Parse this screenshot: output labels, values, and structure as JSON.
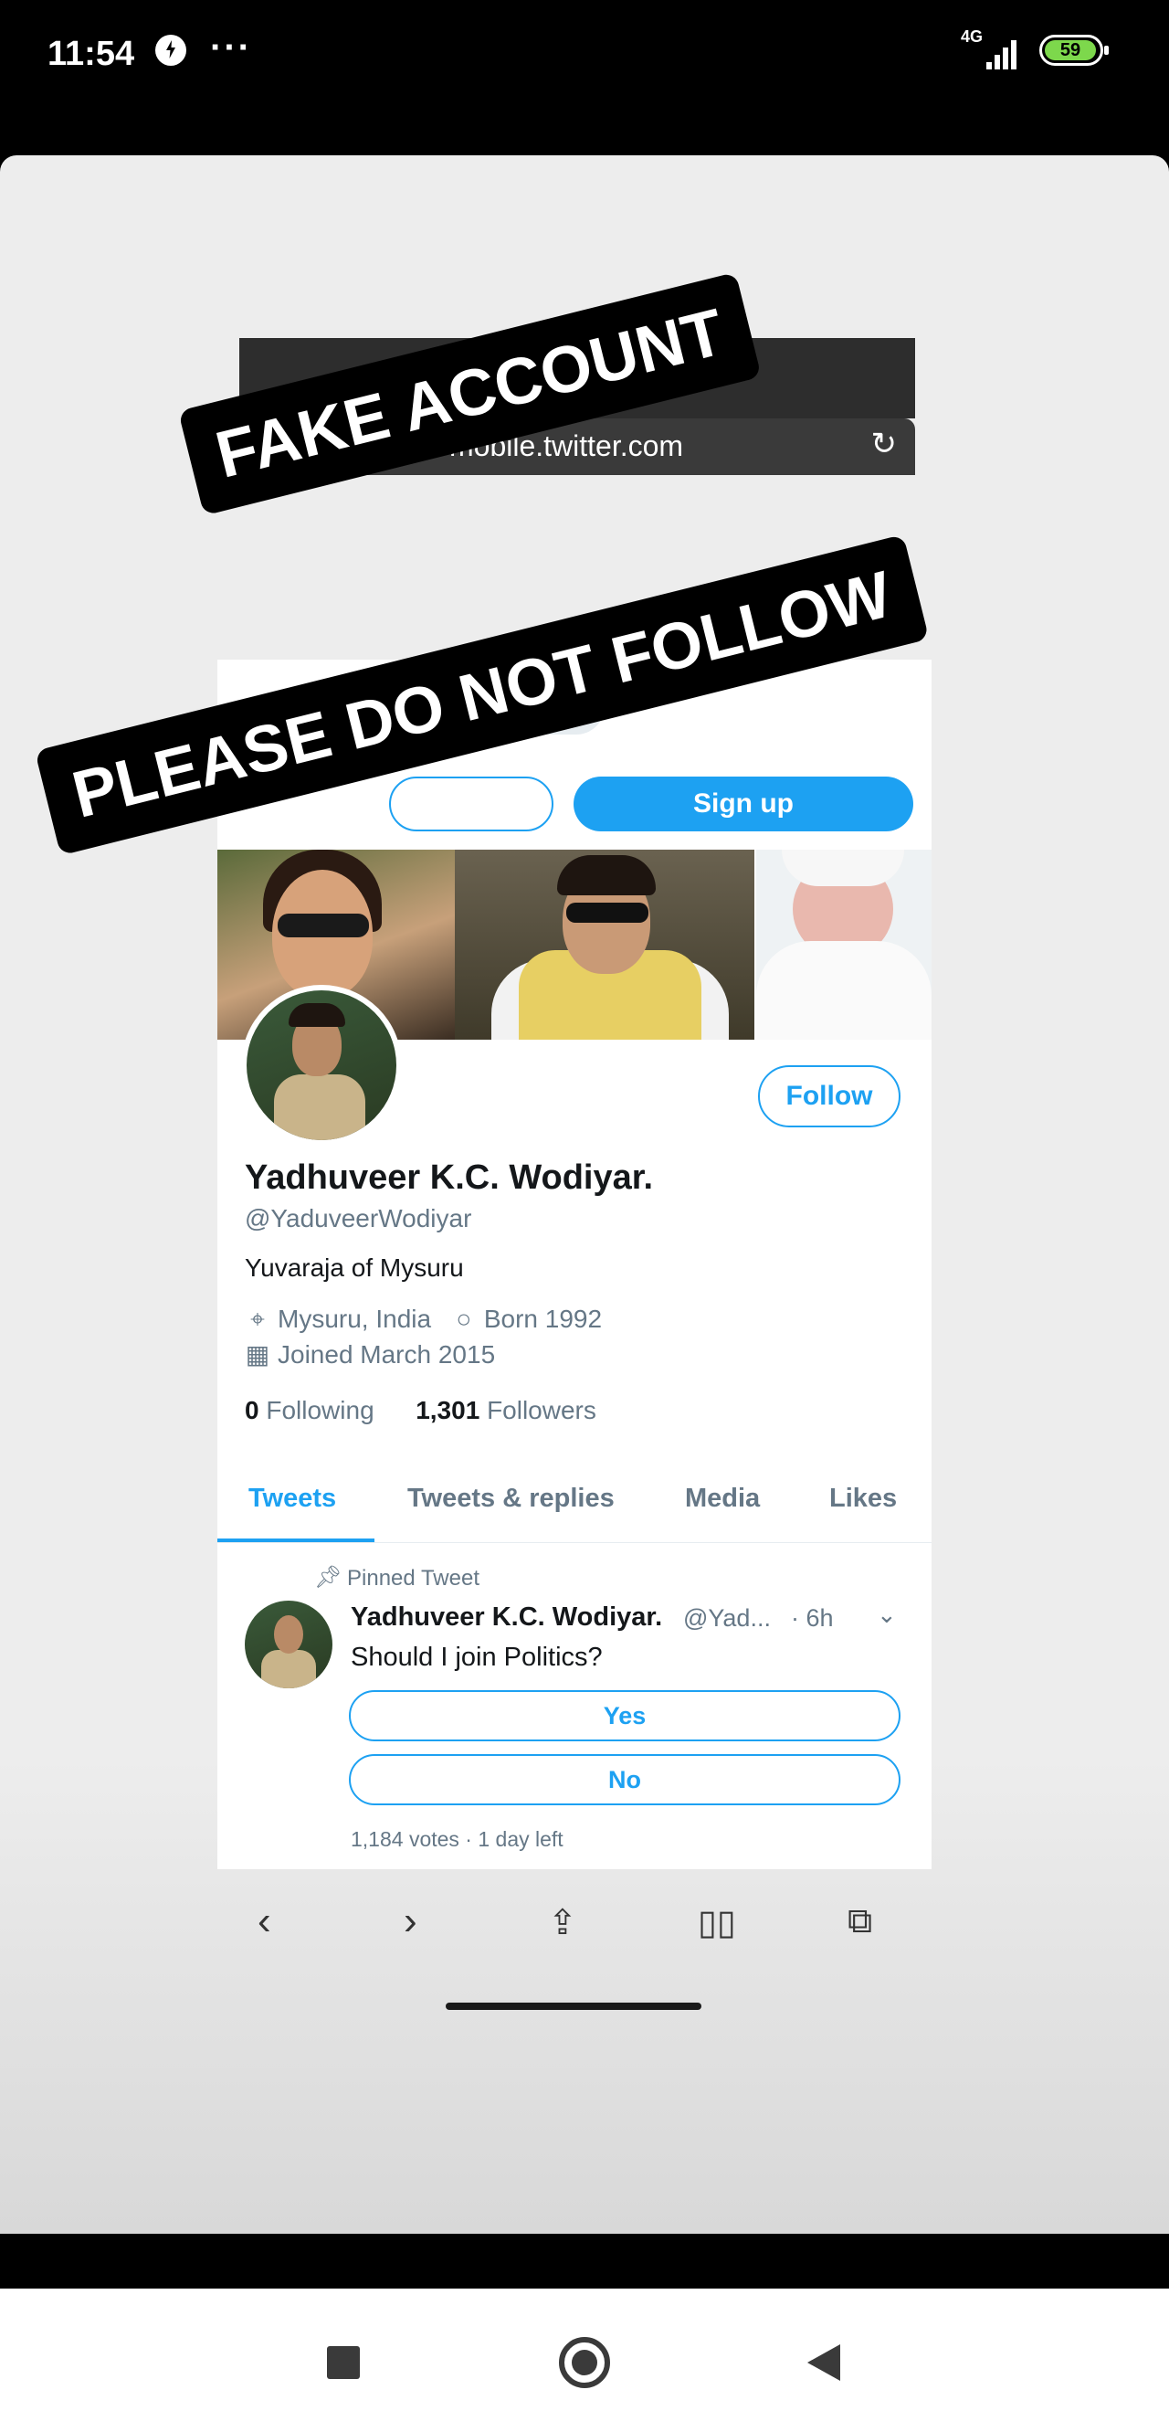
{
  "status_bar": {
    "time": "11:54",
    "overflow": "···",
    "network": "4G",
    "battery": "59"
  },
  "overlay": {
    "line1": "FAKE ACCOUNT",
    "line2": "PLEASE DO NOT FOLLOW"
  },
  "browser": {
    "url": "mobile.twitter.com",
    "back_glyph": "←",
    "signup_label": "Sign up"
  },
  "profile": {
    "name": "Yadhuveer K.C. Wodiyar.",
    "handle": "@YaduveerWodiyar",
    "bio": "Yuvaraja of Mysuru",
    "location": "Mysuru, India",
    "born": "Born 1992",
    "joined": "Joined March 2015",
    "following_count": "0",
    "following_label": "Following",
    "followers_count": "1,301",
    "followers_label": "Followers",
    "follow_label": "Follow"
  },
  "tabs": [
    "Tweets",
    "Tweets & replies",
    "Media",
    "Likes"
  ],
  "tweet": {
    "pinned_label": "Pinned Tweet",
    "author": "Yadhuveer K.C. Wodiyar.",
    "handle": "@Yad...",
    "time": "· 6h",
    "text": "Should I join Politics?",
    "poll_options": [
      "Yes",
      "No"
    ],
    "poll_meta": "1,184 votes · 1 day left"
  },
  "icons": {
    "status": [
      "shield-icon",
      "signal-icon",
      "battery-icon"
    ],
    "browser_nav": [
      "back-icon",
      "forward-icon",
      "share-icon",
      "bookmarks-icon",
      "tabs-icon"
    ],
    "system_nav": [
      "recents-icon",
      "home-icon",
      "back-triangle-icon"
    ]
  }
}
